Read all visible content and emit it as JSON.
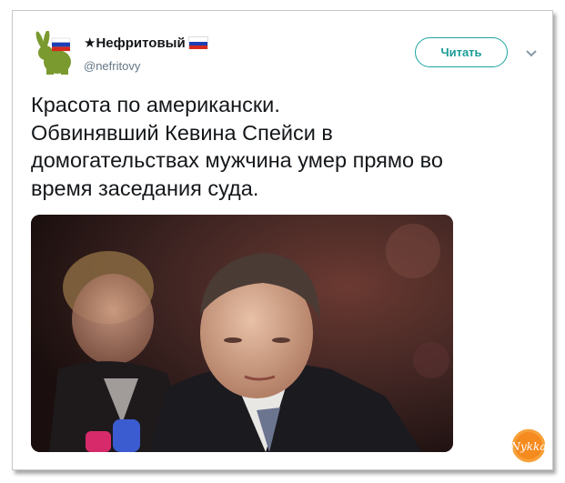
{
  "user": {
    "display_name": "★Нефритовый",
    "handle": "@nefritovy"
  },
  "follow_button": {
    "label": "Читать"
  },
  "tweet": {
    "lines": [
      "Красота по американски.",
      "Обвинявший Кевина Спейси в",
      "домогательствах мужчина умер прямо во",
      "время заседания суда."
    ]
  },
  "watermark": {
    "text": "Nykka"
  },
  "colors": {
    "accent": "#1da1f2",
    "follow_border": "#1da4a0",
    "text": "#14171a",
    "muted": "#657786"
  },
  "icons": {
    "avatar": "green-rabbit-with-flag",
    "dropdown": "chevron-down-icon",
    "flag": "russian-flag"
  }
}
